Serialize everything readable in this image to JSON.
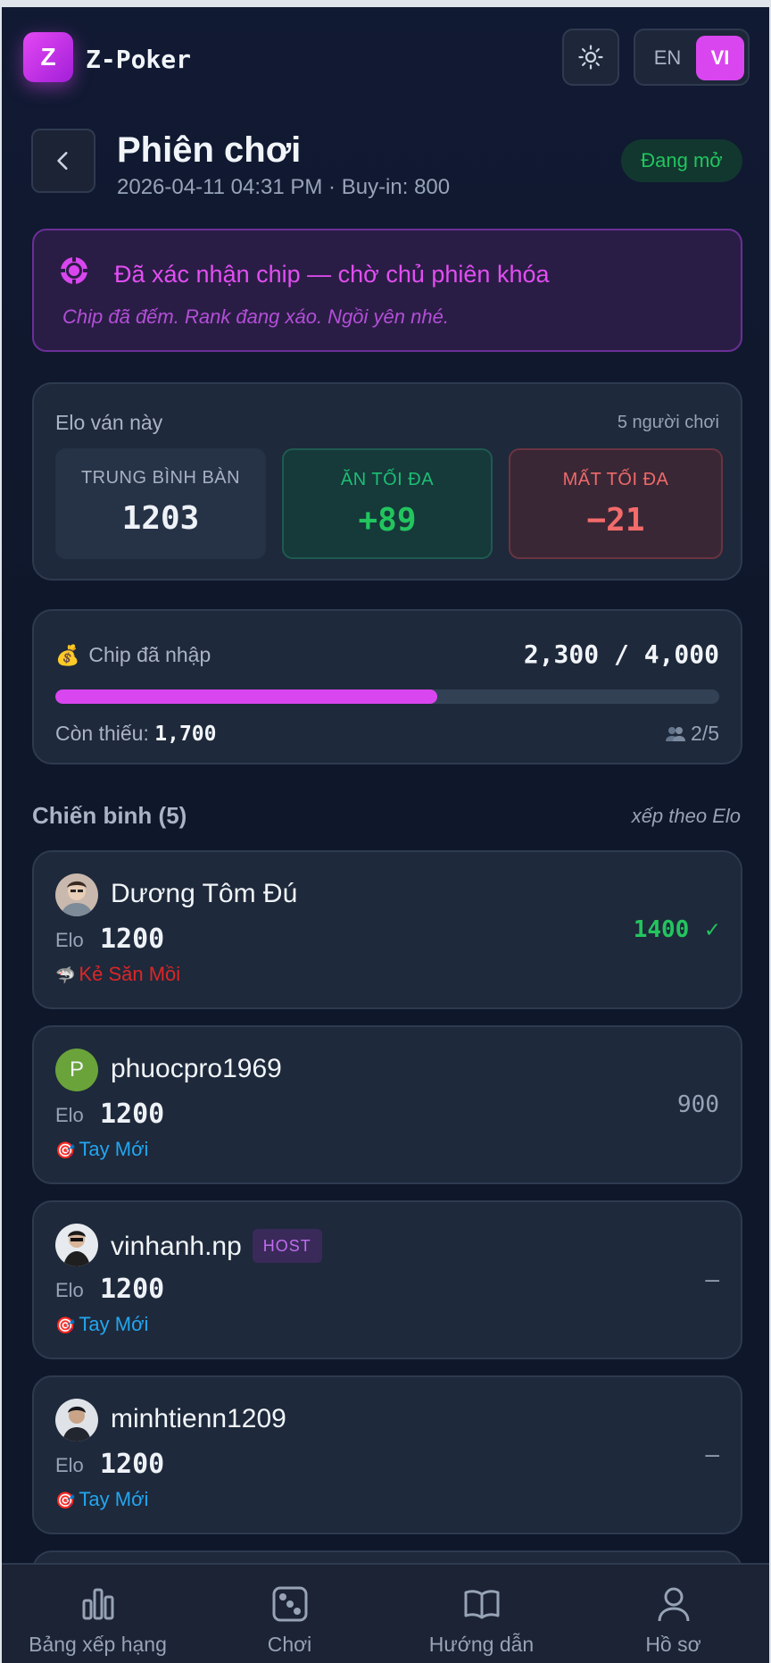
{
  "header": {
    "logo_letter": "Z",
    "brand": "Z-Poker",
    "lang": {
      "en": "EN",
      "vi": "VI",
      "active": "VI"
    }
  },
  "session": {
    "title": "Phiên chơi",
    "subtitle": "2026-04-11 04:31 PM · Buy-in: 800",
    "status": "Đang mở"
  },
  "notice": {
    "title": "Đã xác nhận chip — chờ chủ phiên khóa",
    "desc": "Chip đã đếm. Rank đang xáo. Ngồi yên nhé."
  },
  "elo": {
    "label": "Elo ván này",
    "players_count": "5 người chơi",
    "avg_label": "TRUNG BÌNH BÀN",
    "avg_value": "1203",
    "max_gain_label": "ĂN TỐI ĐA",
    "max_gain_value": "+89",
    "max_loss_label": "MẤT TỐI ĐA",
    "max_loss_value": "−21"
  },
  "chips": {
    "label": "Chip đã nhập",
    "amount": "2,300 / 4,000",
    "progress": 0.575,
    "remain_label": "Còn thiếu:",
    "remain_value": "1,700",
    "players": "2/5"
  },
  "players_section": {
    "title": "Chiến binh (5)",
    "sort": "xếp theo Elo",
    "elo_label": "Elo",
    "host_badge": "HOST"
  },
  "players": [
    {
      "name": "Dương Tôm Đú",
      "elo": "1200",
      "rank": "Kẻ Săn Mồi",
      "rank_icon": "shark-icon",
      "rank_color": "#dc2626",
      "chips": "1400",
      "confirmed": true,
      "host": false,
      "avatar": "photo"
    },
    {
      "name": "phuocpro1969",
      "elo": "1200",
      "rank": "Tay Mới",
      "rank_icon": "target-icon",
      "rank_color": "#22a6f0",
      "chips": "900",
      "confirmed": false,
      "host": false,
      "avatar": "P",
      "avatar_color": "#6aa33a"
    },
    {
      "name": "vinhanh.np",
      "elo": "1200",
      "rank": "Tay Mới",
      "rank_icon": "target-icon",
      "rank_color": "#22a6f0",
      "chips": "–",
      "confirmed": false,
      "host": true,
      "avatar": "photo"
    },
    {
      "name": "minhtienn1209",
      "elo": "1200",
      "rank": "Tay Mới",
      "rank_icon": "target-icon",
      "rank_color": "#22a6f0",
      "chips": "–",
      "confirmed": false,
      "host": false,
      "avatar": "photo"
    }
  ],
  "nav": [
    {
      "label": "Bảng xếp hạng",
      "icon": "bar-chart-icon"
    },
    {
      "label": "Chơi",
      "icon": "dice-icon"
    },
    {
      "label": "Hướng dẫn",
      "icon": "book-icon"
    },
    {
      "label": "Hồ sơ",
      "icon": "user-icon"
    }
  ],
  "colors": {
    "accent": "#d946ef",
    "success": "#22c55e",
    "danger": "#f36b6b",
    "background": "#0f172a",
    "card": "#1e293b"
  }
}
